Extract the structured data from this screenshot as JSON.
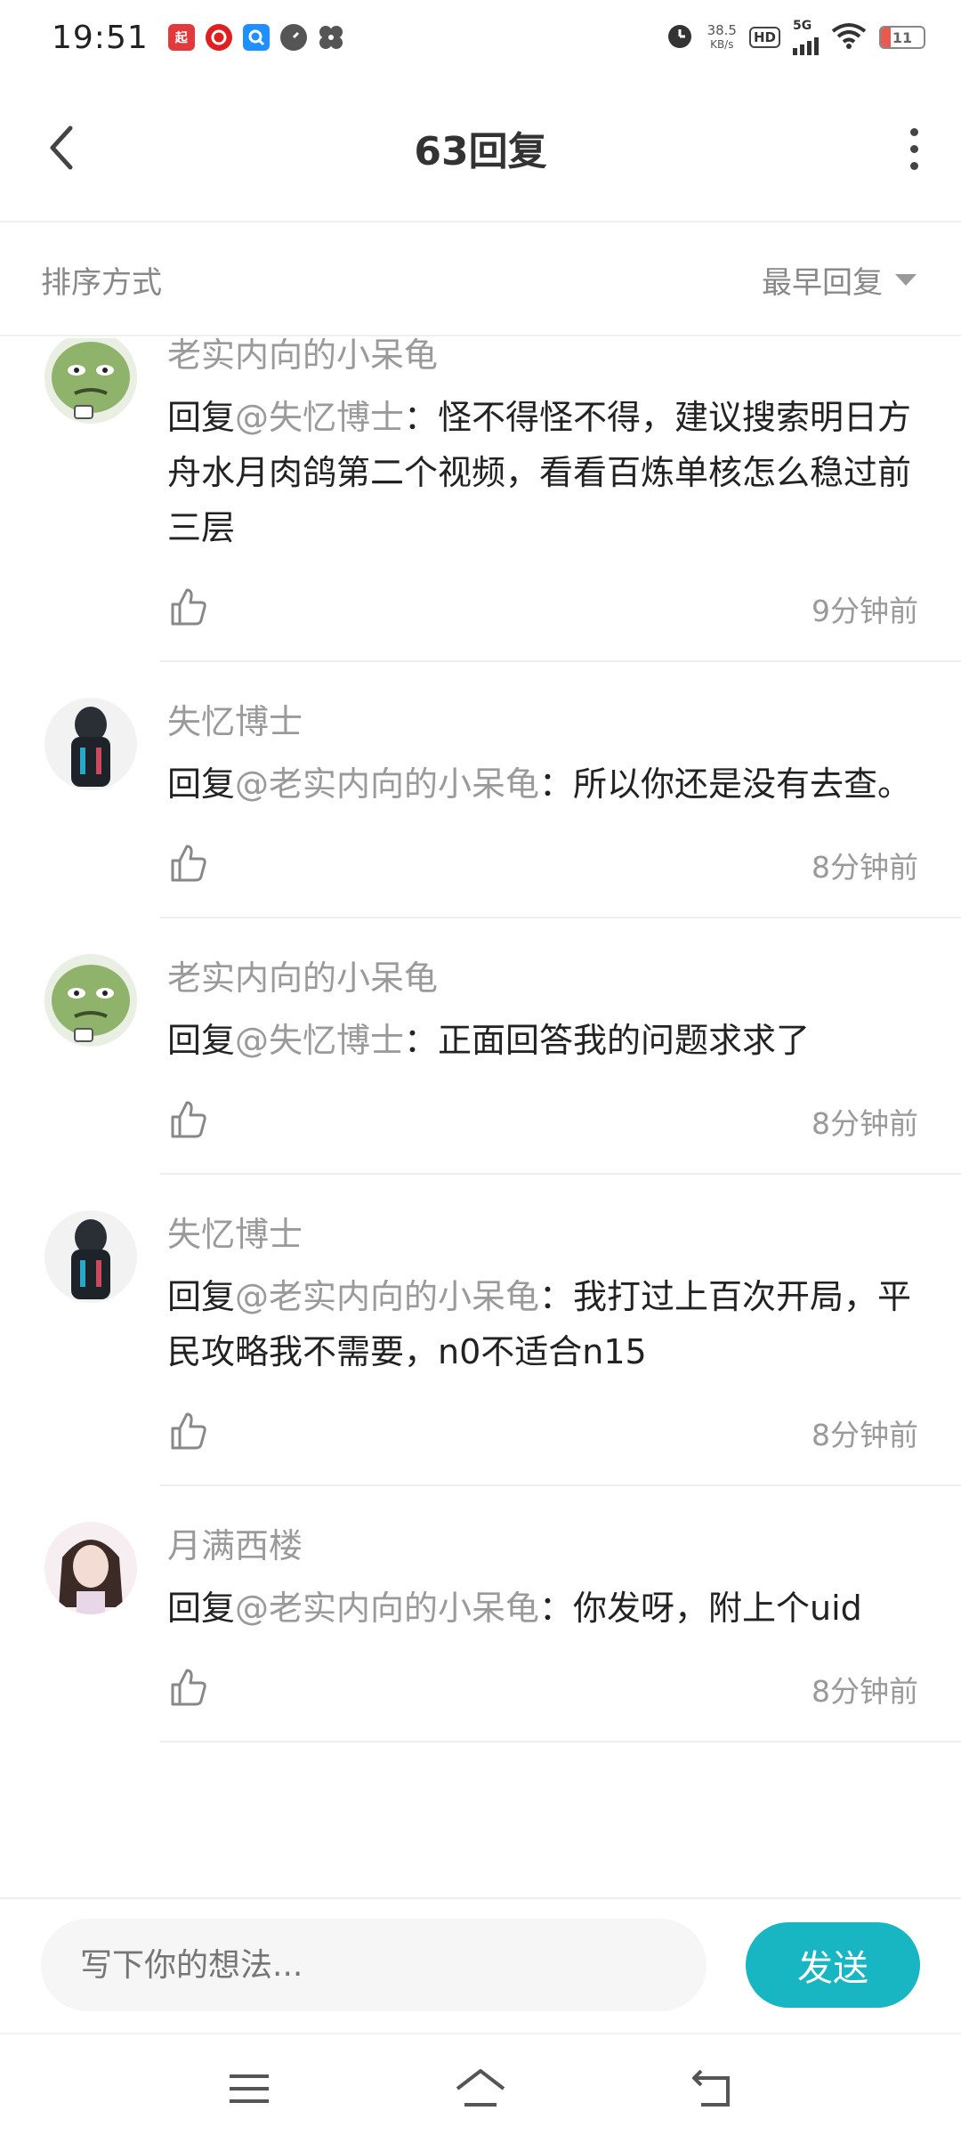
{
  "status_bar": {
    "time": "19:51",
    "network_speed_value": "38.5",
    "network_speed_unit": "KB/s",
    "hd_label": "HD",
    "signal_label": "5G",
    "battery_level": "11",
    "app_icons": [
      "qidian-icon",
      "netease-music-icon",
      "qq-browser-icon",
      "speed-icon",
      "pinwheel-icon"
    ]
  },
  "header": {
    "title": "63回复"
  },
  "sort_bar": {
    "label": "排序方式",
    "selected": "最早回复"
  },
  "comments": [
    {
      "user": "老实内向的小呆龟",
      "reply_prefix": "回复",
      "mention": "@失忆博士",
      "text": "：怪不得怪不得，建议搜索明日方舟水月肉鸽第二个视频，看看百炼单核怎么稳过前三层",
      "time": "9分钟前",
      "avatar": "green-meme-avatar"
    },
    {
      "user": "失忆博士",
      "reply_prefix": "回复",
      "mention": "@老实内向的小呆龟",
      "text": "：所以你还是没有去查。",
      "time": "8分钟前",
      "avatar": "dark-armor-avatar"
    },
    {
      "user": "老实内向的小呆龟",
      "reply_prefix": "回复",
      "mention": "@失忆博士",
      "text": "：正面回答我的问题求求了",
      "time": "8分钟前",
      "avatar": "green-meme-avatar"
    },
    {
      "user": "失忆博士",
      "reply_prefix": "回复",
      "mention": "@老实内向的小呆龟",
      "text": "：我打过上百次开局，平民攻略我不需要，n0不适合n15",
      "time": "8分钟前",
      "avatar": "dark-armor-avatar"
    },
    {
      "user": "月满西楼",
      "reply_prefix": "回复",
      "mention": "@老实内向的小呆龟",
      "text": "：你发呀，附上个uid",
      "time": "8分钟前",
      "avatar": "anime-girl-avatar"
    }
  ],
  "input_bar": {
    "placeholder": "写下你的想法...",
    "send_label": "发送"
  },
  "colors": {
    "accent": "#18b6c2",
    "muted_text": "#9a9a9a",
    "divider": "#eeeeee"
  }
}
